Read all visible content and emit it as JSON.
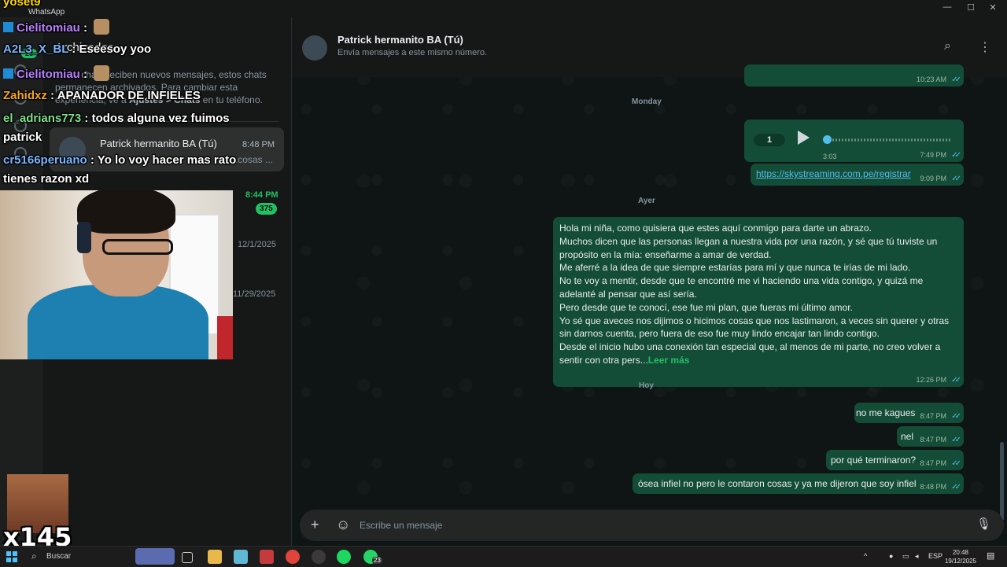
{
  "window": {
    "app_title": "WhatsApp",
    "badge": "23"
  },
  "chat_list": {
    "archived_title": "Archivados",
    "archived_info_prefix": "Estos chats reciben nuevos mensajes, estos chats permanecen archivados. Para cambiar esta experiencia, ve a ",
    "archived_info_bold": "Ajustes > Chats",
    "archived_info_suffix": " en tu teléfono.",
    "rows": [
      {
        "name": "Patrick hermanito BA (Tú)",
        "time": "8:48 PM",
        "preview": "..cosas ..."
      }
    ],
    "times": [
      "8:44 PM",
      "12/1/2025",
      "11/29/2025"
    ],
    "unread_count": "375"
  },
  "conversation": {
    "title": "Patrick hermanito BA (Tú)",
    "subtitle": "Envía mensajes a este mismo número.",
    "days": [
      "Monday",
      "Ayer",
      "Hoy"
    ],
    "messages": [
      {
        "kind": "media",
        "time": "10:23 AM"
      },
      {
        "kind": "voice",
        "speed": "1",
        "duration": "3:03",
        "time": "7:49 PM"
      },
      {
        "kind": "link",
        "text": "https://skystreaming.com.pe/registrar",
        "time": "9:09 PM"
      },
      {
        "kind": "text",
        "time": "12:26 PM",
        "lines": [
          "Hola mi niña, como quisiera que estes aquí conmigo para darte un abrazo.",
          "Muchos dicen que las personas llegan a nuestra vida por una razón, y sé que tú tuviste un propósito en la mía: enseñarme a amar de verdad.",
          "Me aferré a la idea de que siempre estarías para mí y que nunca te irías de mi lado.",
          "No te voy a mentir, desde que te encontré me vi haciendo una vida contigo, y quizá me adelanté al pensar que así sería.",
          "Pero desde que te conocí, ese fue mi plan, que fueras mi último amor.",
          "Yo sé que aveces nos dijimos o hicimos cosas que nos lastimaron, a veces sin querer y otras sin darnos cuenta, pero fuera de eso fue muy lindo encajar tan lindo contigo.",
          "Desde el inicio hubo una conexión tan especial que, al menos de mi parte, no creo volver a sentir con otra pers..."
        ],
        "read_more": "Leer más"
      },
      {
        "kind": "text",
        "text": "no me kagues",
        "time": "8:47 PM"
      },
      {
        "kind": "text",
        "text": "nel",
        "time": "8:47 PM"
      },
      {
        "kind": "text",
        "text": "por qué terminaron?",
        "time": "8:47 PM"
      },
      {
        "kind": "text",
        "text": "ósea infiel no pero le contaron cosas y ya me dijeron que soy infiel",
        "time": "8:48 PM"
      }
    ],
    "composer_placeholder": "Escribe un mensaje"
  },
  "stream_chat": [
    {
      "user": "yoset9",
      "color": "#ffd900",
      "msg": ""
    },
    {
      "user": "Cielitomiau",
      "color": "#b980ff",
      "msg": "",
      "badge": true,
      "emote": true
    },
    {
      "user": "A2L3_X_BL",
      "color": "#7ab6ff",
      "msg": "Eseesoy yoo"
    },
    {
      "user": "Cielitomiau",
      "color": "#b980ff",
      "msg": "",
      "badge": true,
      "emote": true
    },
    {
      "user": "Zahidxz",
      "color": "#f5a623",
      "msg": "APANADOR DE INFIELES"
    },
    {
      "user": "el_adrians773",
      "color": "#7fe08a",
      "msg": "todos alguna vez fuimos"
    },
    {
      "user": "",
      "color": "#ffffff",
      "msg": "patrick"
    },
    {
      "user": "cr5166peruano",
      "color": "#7ab6ff",
      "msg": "Yo lo voy hacer mas rato"
    },
    {
      "user": "",
      "color": "#ffffff",
      "msg": "tienes razon xd"
    }
  ],
  "overlay": {
    "multiplier": "x145"
  },
  "taskbar": {
    "search_label": "Buscar",
    "whatsapp_badge": "23",
    "lang": "ESP",
    "time": "20:48",
    "date": "19/12/2025"
  }
}
